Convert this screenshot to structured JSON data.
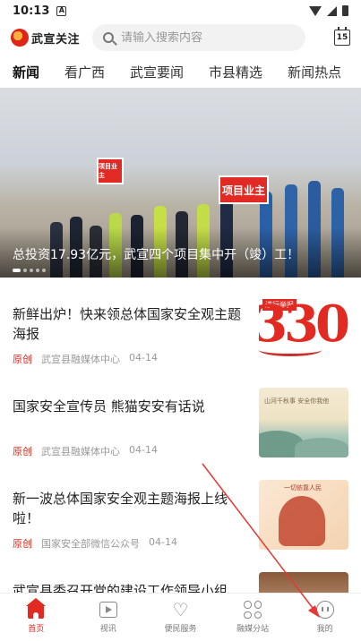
{
  "status_bar": {
    "time": "10:13",
    "notification_badge": "A"
  },
  "header": {
    "app_name": "武宣关注",
    "search_placeholder": "请输入搜索内容",
    "calendar_day": "15"
  },
  "tabs": [
    {
      "label": "新闻",
      "active": true
    },
    {
      "label": "看广西",
      "active": false
    },
    {
      "label": "武宣要闻",
      "active": false
    },
    {
      "label": "市县精选",
      "active": false
    },
    {
      "label": "新闻热点",
      "active": false
    }
  ],
  "hero": {
    "caption": "总投资17.93亿元，武宣四个项目集中开（竣）工！",
    "sign_left": "项目业主",
    "sign_right": "项目业主"
  },
  "news": [
    {
      "title": "新鲜出炉！快来领总体国家安全观主题海报",
      "tag": "原创",
      "source": "武宣县融媒体中心",
      "date": "04-14",
      "thumb_label": "进行举报",
      "thumb_big": "330"
    },
    {
      "title": "国家安全宣传员 熊猫安安有话说",
      "tag": "原创",
      "source": "武宣县融媒体中心",
      "date": "04-14",
      "thumb_label": "山河千秋事 安全你我他"
    },
    {
      "title": "新一波总体国家安全观主题海报上线啦！",
      "tag": "原创",
      "source": "国家安全部微信公众号",
      "date": "04-14",
      "thumb_label": "一切依靠人民"
    },
    {
      "title": "武宣县委召开党的建设工作领导小组",
      "tag": "",
      "source": "",
      "date": ""
    }
  ],
  "bottom_nav": [
    {
      "label": "首页",
      "icon": "home-icon",
      "active": true
    },
    {
      "label": "视讯",
      "icon": "video-icon",
      "active": false
    },
    {
      "label": "便民服务",
      "icon": "heart-icon",
      "active": false
    },
    {
      "label": "融媒分站",
      "icon": "grid-icon",
      "active": false
    },
    {
      "label": "我的",
      "icon": "face-icon",
      "active": false
    }
  ],
  "colors": {
    "brand_red": "#e22a22",
    "annotation_arrow": "#e53935"
  }
}
